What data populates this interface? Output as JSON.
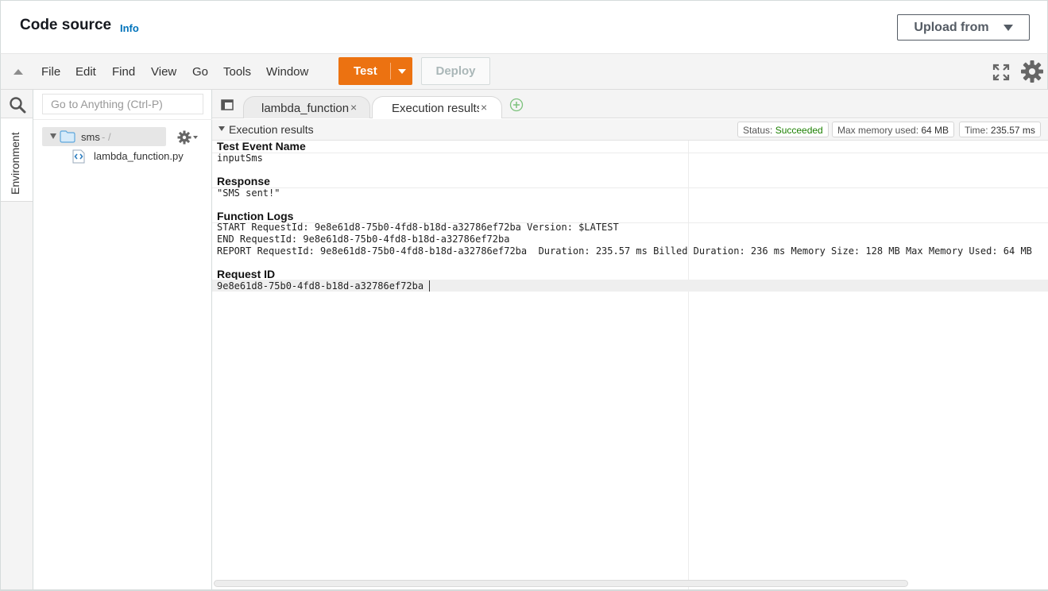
{
  "header": {
    "title": "Code source",
    "info": "Info",
    "upload_label": "Upload from"
  },
  "menu": {
    "items": [
      "File",
      "Edit",
      "Find",
      "View",
      "Go",
      "Tools",
      "Window"
    ],
    "test_label": "Test",
    "deploy_label": "Deploy"
  },
  "sidebar": {
    "environment_label": "Environment",
    "goto_placeholder": "Go to Anything (Ctrl-P)",
    "folder_name": "sms",
    "folder_path": "- /",
    "file_name": "lambda_function.py"
  },
  "tabs": [
    {
      "label": "lambda_function.",
      "close": "×"
    },
    {
      "label": "Execution results",
      "close": "×"
    }
  ],
  "results": {
    "title": "Execution results",
    "status_label": "Status: ",
    "status_value": "Succeeded",
    "memory_label": "Max memory used: ",
    "memory_value": "64 MB",
    "time_label": "Time: ",
    "time_value": "235.57 ms",
    "test_event_heading": "Test Event Name",
    "test_event_value": "inputSms",
    "response_heading": "Response",
    "response_value": "\"SMS sent!\"",
    "logs_heading": "Function Logs",
    "log_lines": [
      "START RequestId: 9e8e61d8-75b0-4fd8-b18d-a32786ef72ba Version: $LATEST",
      "END RequestId: 9e8e61d8-75b0-4fd8-b18d-a32786ef72ba",
      "REPORT RequestId: 9e8e61d8-75b0-4fd8-b18d-a32786ef72ba  Duration: 235.57 ms Billed Duration: 236 ms Memory Size: 128 MB Max Memory Used: 64 MB"
    ],
    "request_id_heading": "Request ID",
    "request_id_value": "9e8e61d8-75b0-4fd8-b18d-a32786ef72ba"
  },
  "colors": {
    "accent": "#ec7211",
    "link": "#0073bb",
    "success": "#1d8102"
  }
}
